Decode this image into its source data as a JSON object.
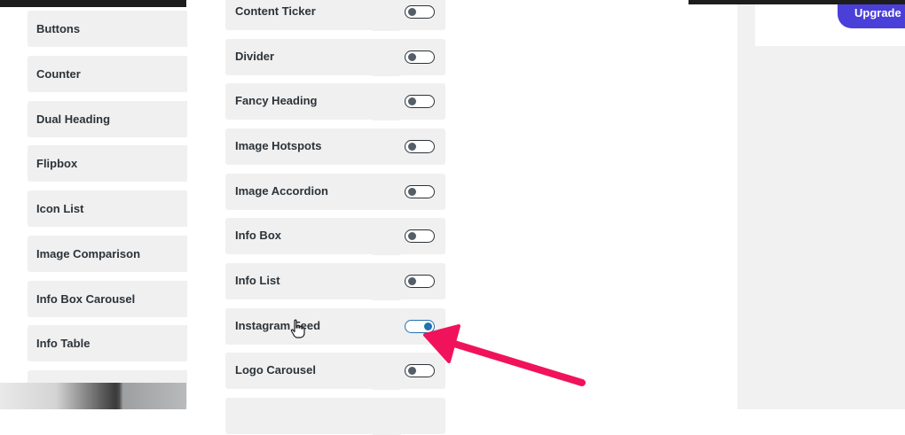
{
  "header": {
    "upgrade_label": "Upgrade N"
  },
  "left_column": {
    "items": [
      {
        "label": "Buttons"
      },
      {
        "label": "Counter"
      },
      {
        "label": "Dual Heading"
      },
      {
        "label": "Flipbox"
      },
      {
        "label": "Icon List"
      },
      {
        "label": "Image Comparison"
      },
      {
        "label": "Info Box Carousel"
      },
      {
        "label": "Info Table"
      }
    ]
  },
  "right_column": {
    "items": [
      {
        "label": "Content Ticker",
        "enabled": false
      },
      {
        "label": "Divider",
        "enabled": false
      },
      {
        "label": "Fancy Heading",
        "enabled": false
      },
      {
        "label": "Image Hotspots",
        "enabled": false
      },
      {
        "label": "Image Accordion",
        "enabled": false
      },
      {
        "label": "Info Box",
        "enabled": false
      },
      {
        "label": "Info List",
        "enabled": false
      },
      {
        "label": "Instagram Feed",
        "enabled": true
      },
      {
        "label": "Logo Carousel",
        "enabled": false
      }
    ]
  },
  "colors": {
    "accent": "#4a3fd8",
    "toggle_on": "#2271b1",
    "annotation_arrow": "#f0135b",
    "card_background": "#f0f0f1"
  },
  "icons": [
    "hand-pointer-icon",
    "annotation-arrow-icon"
  ]
}
